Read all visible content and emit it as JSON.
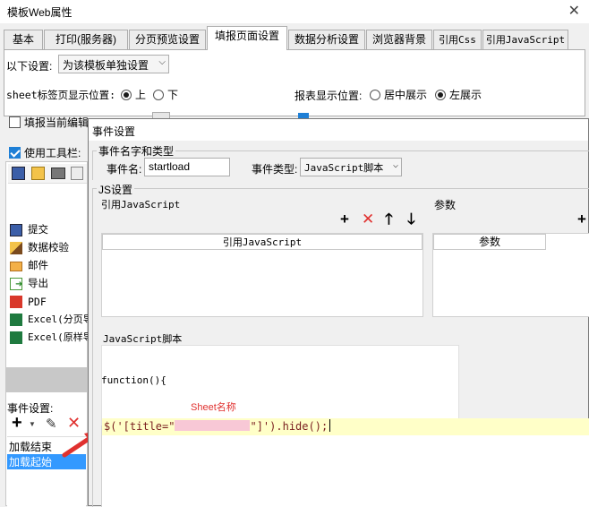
{
  "window": {
    "title": "模板Web属性",
    "close_glyph": "✕"
  },
  "tabs": [
    {
      "label": "基本"
    },
    {
      "label": "打印(服务器)"
    },
    {
      "label": "分页预览设置"
    },
    {
      "label": "填报页面设置",
      "active": true
    },
    {
      "label": "数据分析设置"
    },
    {
      "label": "浏览器背景"
    },
    {
      "label": "引用Css"
    },
    {
      "label": "引用JavaScript"
    }
  ],
  "settings": {
    "scope_label": "以下设置:",
    "scope_value": "为该模板单独设置",
    "sheet_pos_label": "sheet标签页显示位置:",
    "sheet_pos_options": [
      "上",
      "下"
    ],
    "report_pos_label": "报表显示位置:",
    "report_pos_options": [
      "居中展示",
      "左展示"
    ],
    "fill_current_label": "填报当前编辑",
    "use_toolbar_label": "使用工具栏:"
  },
  "toolbar_items": [
    {
      "label": "提交",
      "icon": "submit-icon"
    },
    {
      "label": "数据校验",
      "icon": "verify-icon"
    },
    {
      "label": "邮件",
      "icon": "mail-icon"
    },
    {
      "label": "导出",
      "icon": "export-icon"
    },
    {
      "label": "PDF",
      "icon": "pdf-icon"
    },
    {
      "label": "Excel(分页导",
      "icon": "excel-icon"
    },
    {
      "label": "Excel(原样导",
      "icon": "excel-icon"
    }
  ],
  "event_settings": {
    "label": "事件设置:",
    "events": [
      "加载结束",
      "加载起始"
    ],
    "selected_index": 1
  },
  "dialog": {
    "title": "事件设置",
    "name_type_group": "事件名字和类型",
    "event_name_label": "事件名:",
    "event_name_value": "startload",
    "event_type_label": "事件类型:",
    "event_type_value": "JavaScript脚本",
    "js_group": "JS设置",
    "ref_js_label": "引用JavaScript",
    "params_label": "参数",
    "ref_js_header": "引用JavaScript",
    "params_header": "参数",
    "script_label": "JavaScript脚本",
    "code_line1": "function(){",
    "code_line2_prefix": "$('[title=\"",
    "code_line2_suffix": "\"]').hide();",
    "annotation": "Sheet名称"
  },
  "colors": {
    "accent_blue": "#1e7fd6",
    "selection_blue": "#3399ff",
    "annotation_red": "#e0312f",
    "highlight_yellow": "#ffffc8",
    "redacted_pink": "#f8c8d6"
  }
}
